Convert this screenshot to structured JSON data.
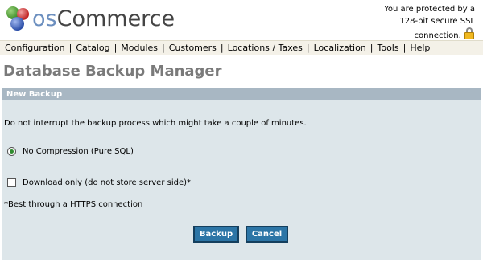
{
  "logo": {
    "prefix": "os",
    "rest": "Commerce"
  },
  "ssl": {
    "line1": "You are protected by a",
    "line2": "128-bit secure SSL",
    "line3": "connection."
  },
  "menu": [
    "Configuration",
    "Catalog",
    "Modules",
    "Customers",
    "Locations / Taxes",
    "Localization",
    "Tools",
    "Help"
  ],
  "page_title": "Database Backup Manager",
  "panel": {
    "header": "New Backup",
    "intro": "Do not interrupt the backup process which might take a couple of minutes.",
    "radio_label": "No Compression (Pure SQL)",
    "radio_checked": true,
    "checkbox_label": "Download only (do not store server side)*",
    "checkbox_checked": false,
    "note": "*Best through a HTTPS connection"
  },
  "buttons": {
    "backup": "Backup",
    "cancel": "Cancel"
  },
  "colors": {
    "menu_bg": "#f4f1e8",
    "panel_bg": "#dde6ea",
    "panel_header": "#a8b7c3",
    "button": "#2c75a6",
    "title": "#7a7a7a"
  },
  "icons": {
    "logo": "oscommerce-balls-icon",
    "lock": "lock-icon"
  }
}
